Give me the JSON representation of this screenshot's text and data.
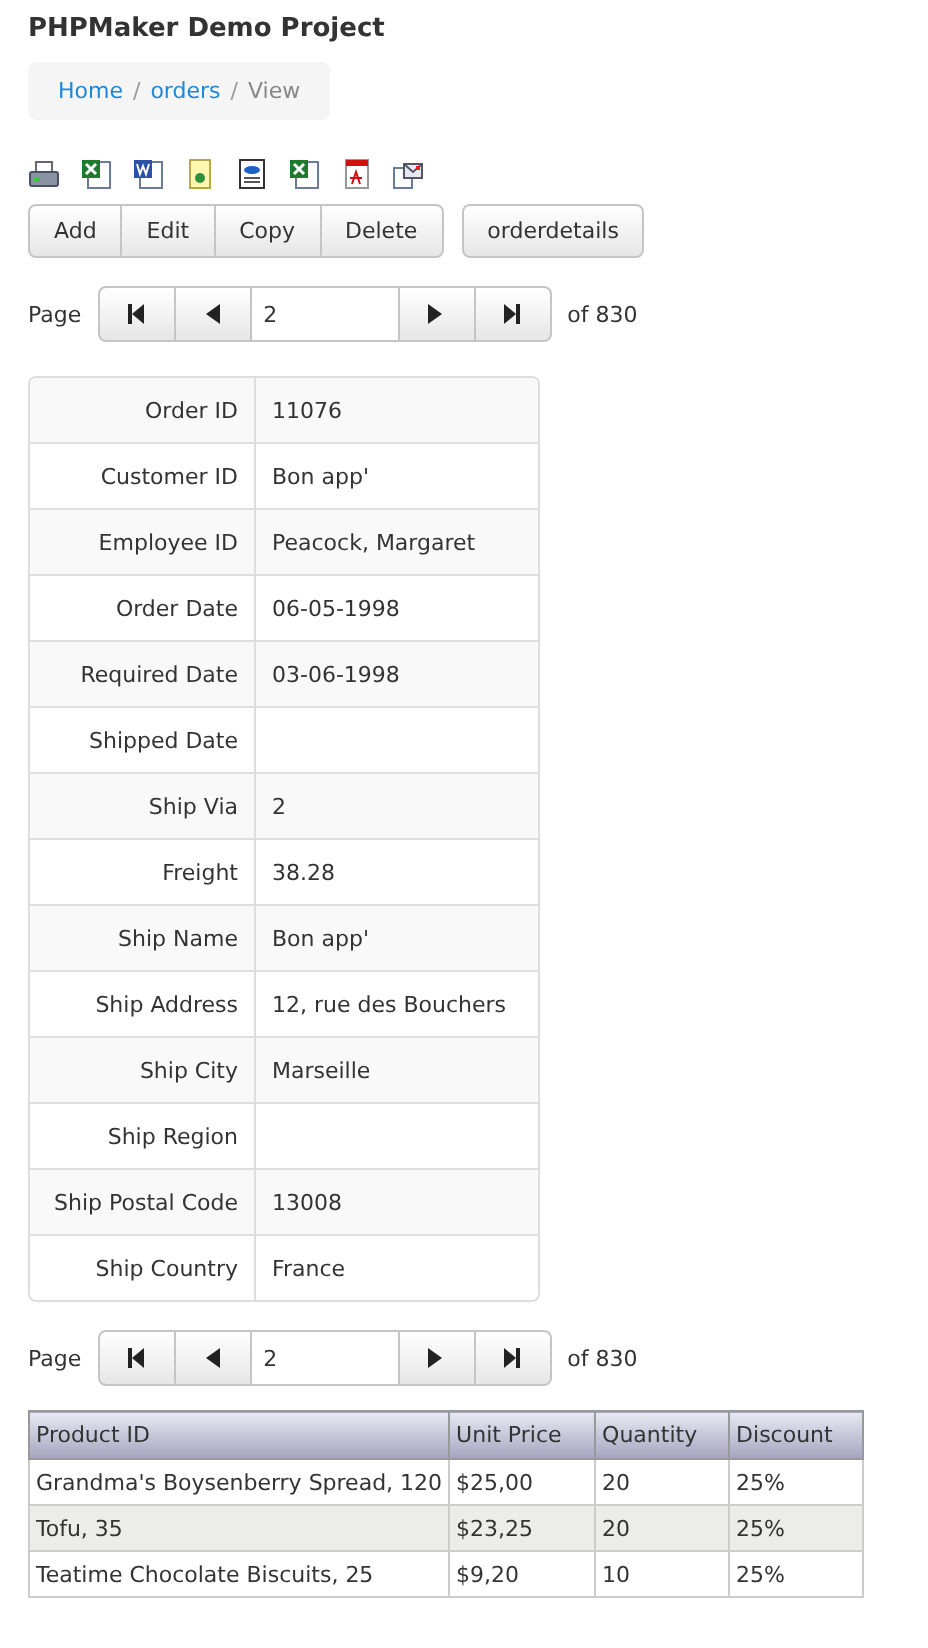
{
  "header": {
    "title": "PHPMaker Demo Project"
  },
  "breadcrumb": {
    "separator": "/",
    "items": [
      {
        "label": "Home",
        "kind": "link"
      },
      {
        "label": "orders",
        "kind": "link"
      },
      {
        "label": "View",
        "kind": "current"
      }
    ]
  },
  "actions": [
    "Add",
    "Edit",
    "Copy",
    "Delete"
  ],
  "detail_button": "orderdetails",
  "pagers": [
    {
      "label": "Page",
      "page": "2",
      "total": "of 830"
    },
    {
      "label": "Page",
      "page": "2",
      "total": "of 830"
    }
  ],
  "record": [
    {
      "label": "Order ID",
      "value": "11076"
    },
    {
      "label": "Customer ID",
      "value": "Bon app'"
    },
    {
      "label": "Employee ID",
      "value": "Peacock, Margaret"
    },
    {
      "label": "Order Date",
      "value": "06-05-1998"
    },
    {
      "label": "Required Date",
      "value": "03-06-1998"
    },
    {
      "label": "Shipped Date"
    },
    {
      "label": "Ship Via",
      "value": "2"
    },
    {
      "label": "Freight",
      "value": "38.28"
    },
    {
      "label": "Ship Name",
      "value": "Bon app'"
    },
    {
      "label": "Ship Address",
      "value": "12, rue des Bouchers"
    },
    {
      "label": "Ship City",
      "value": "Marseille"
    },
    {
      "label": "Ship Region"
    },
    {
      "label": "Ship Postal Code",
      "value": "13008"
    },
    {
      "label": "Ship Country",
      "value": "France"
    }
  ],
  "details_table": {
    "columns": [
      "Product ID",
      "Unit Price",
      "Quantity",
      "Discount"
    ],
    "rows": [
      [
        "Grandma's Boysenberry Spread, 120",
        "$25,00",
        "20",
        "25%"
      ],
      [
        "Tofu, 35",
        "$23,25",
        "20",
        "25%"
      ],
      [
        "Teatime Chocolate Biscuits, 25",
        "$9,20",
        "10",
        "25%"
      ]
    ]
  }
}
